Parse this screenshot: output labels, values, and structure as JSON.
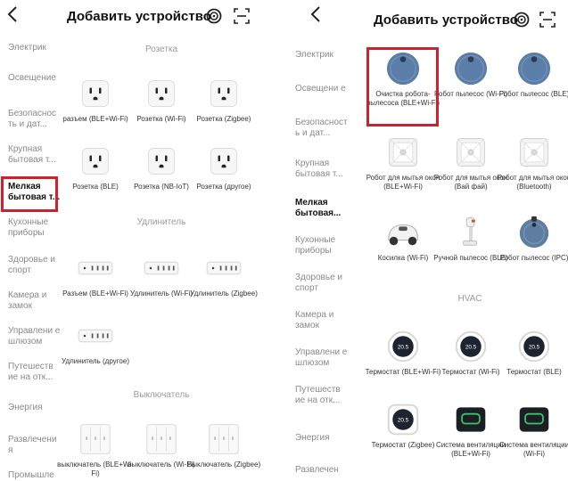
{
  "left": {
    "title": "Добавить устройство",
    "sidebar": [
      "Электрик",
      "Освещение",
      "Безопаснос ть и дат...",
      "Крупная бытовая т...",
      "Мелкая бытовая т...",
      "Кухонные приборы",
      "Здоровье и спорт",
      "Камера и замок",
      "Управлени е шлюзом",
      "Путешеств ие на отк...",
      "Энергия",
      "Развлечени я",
      "Промышле"
    ],
    "sections": [
      {
        "title": "Розетка",
        "devices": [
          {
            "icon": "socket-icon",
            "label": "разъем (BLE+Wi-Fi)"
          },
          {
            "icon": "socket-icon",
            "label": "Розетка (Wi-Fi)"
          },
          {
            "icon": "socket-icon",
            "label": "Розетка (Zigbee)"
          },
          {
            "icon": "socket-icon",
            "label": "Розетка (BLE)"
          },
          {
            "icon": "socket-icon",
            "label": "Розетка (NB-IoT)"
          },
          {
            "icon": "socket-icon",
            "label": "Розетка (другое)"
          }
        ]
      },
      {
        "title": "Удлинитель",
        "devices": [
          {
            "icon": "power-strip-icon",
            "label": "Разъем (BLE+Wi-Fi)"
          },
          {
            "icon": "power-strip-icon",
            "label": "Удлинитель (Wi-Fi)"
          },
          {
            "icon": "power-strip-icon",
            "label": "Удлинитель (Zigbee)"
          },
          {
            "icon": "power-strip-icon",
            "label": "Удлинитель (другое)"
          }
        ]
      },
      {
        "title": "Выключатель",
        "devices": [
          {
            "icon": "wall-switch-icon",
            "label": "выключатель (BLE+Wi-Fi)"
          },
          {
            "icon": "wall-switch-icon",
            "label": "выключатель (Wi-Fi)"
          },
          {
            "icon": "wall-switch-icon",
            "label": "Выключатель (Zigbee)"
          }
        ]
      }
    ]
  },
  "right": {
    "title": "Добавить устройство",
    "sidebar": [
      "Электрик",
      "Освещени е",
      "Безопасност ь и дат...",
      "Крупная бытовая т...",
      "Мелкая бытовая...",
      "Кухонные приборы",
      "Здоровье и спорт",
      "Камера и замок",
      "Управлени е шлюзом",
      "Путешеств ие на отк...",
      "Энергия",
      "Развлечен"
    ],
    "sections": [
      {
        "title": "",
        "devices": [
          {
            "icon": "robot-vacuum-icon",
            "label": "Очистка робота-пылесоса (BLE+Wi-Fi)"
          },
          {
            "icon": "robot-vacuum-icon",
            "label": "Робот пылесос (Wi-Fi)"
          },
          {
            "icon": "robot-vacuum-icon",
            "label": "Робот пылесос (BLE)"
          },
          {
            "icon": "window-robot-icon",
            "label": "Робот для мытья окон (BLE+Wi-Fi)"
          },
          {
            "icon": "window-robot-icon",
            "label": "Робот для мытья окон (Вай фай)"
          },
          {
            "icon": "window-robot-icon",
            "label": "Робот для мытья окон (Bluetooth)"
          },
          {
            "icon": "mower-icon",
            "label": "Косилка (Wi-Fi)"
          },
          {
            "icon": "handheld-vacuum-icon",
            "label": "Ручной пылесос (BLE)"
          },
          {
            "icon": "camera-vacuum-icon",
            "label": "Робот пылесос (IPC)"
          }
        ]
      },
      {
        "title": "HVAC",
        "devices": [
          {
            "icon": "thermostat-icon",
            "label": "Термостат (BLE+Wi-Fi)",
            "display": "20.5"
          },
          {
            "icon": "thermostat-icon",
            "label": "Термостат (Wi-Fi)",
            "display": "20.5"
          },
          {
            "icon": "thermostat-icon",
            "label": "Термостат (BLE)",
            "display": "20.5"
          },
          {
            "icon": "thermostat-square-icon",
            "label": "Термостат (Zigbee)",
            "display": "20.5"
          },
          {
            "icon": "ventilation-icon",
            "label": "Система вентиляции (BLE+Wi-Fi)"
          },
          {
            "icon": "ventilation-icon",
            "label": "Система вентиляции (Wi-Fi)"
          }
        ]
      }
    ]
  },
  "colors": {
    "highlight": "#d0202c",
    "active_text": "#111111",
    "inactive_text": "#8a8a8a",
    "vacuum_blue": "#5b7ea8"
  }
}
